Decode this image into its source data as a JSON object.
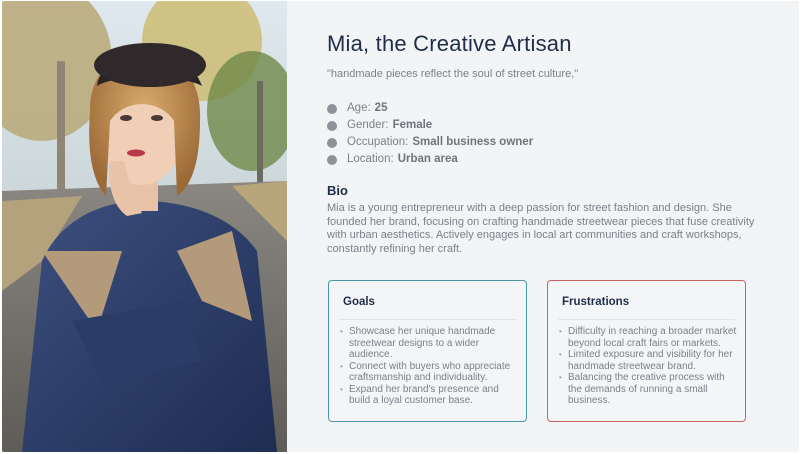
{
  "persona": {
    "title": "Mia, the Creative Artisan",
    "quote": "\"handmade pieces reflect the soul of street culture,\"",
    "facts": [
      {
        "label": "Age:",
        "value": "25"
      },
      {
        "label": "Gender:",
        "value": "Female"
      },
      {
        "label": "Occupation:",
        "value": "Small business owner"
      },
      {
        "label": "Location:",
        "value": "Urban area"
      }
    ],
    "bio_heading": "Bio",
    "bio_text": "Mia is a young entrepreneur with a deep passion for street fashion and design. She founded her brand, focusing on crafting handmade streetwear pieces that fuse creativity with urban aesthetics. Actively engages in local art communities and craft workshops, constantly refining her craft."
  },
  "goals": {
    "heading": "Goals",
    "items": [
      "Showcase her unique handmade streetwear designs to a wider audience.",
      "Connect with buyers who appreciate craftsmanship and individuality.",
      "Expand her brand's presence and build a loyal customer base."
    ]
  },
  "frustrations": {
    "heading": "Frustrations",
    "items": [
      "Difficulty in reaching a broader market beyond local craft fairs or markets.",
      "Limited exposure and visibility for her handmade streetwear brand.",
      "Balancing the creative process with the demands of running a small business."
    ]
  },
  "colors": {
    "card_bg": "#f3f4f6",
    "title": "#1f2d4a",
    "goals_border": "#4a97a8",
    "frustrations_border": "#c9625f"
  }
}
